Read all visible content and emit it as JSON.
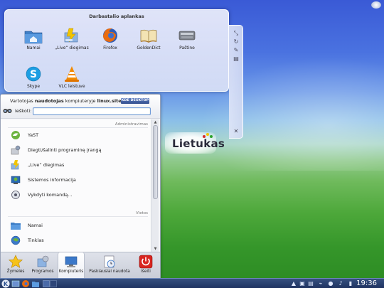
{
  "folderview": {
    "title": "Darbastalio aplankas",
    "icons": [
      {
        "label": "Namai",
        "icon": "home-folder-icon"
      },
      {
        "label": "„Live“ diegimas",
        "icon": "live-install-icon"
      },
      {
        "label": "Firefox",
        "icon": "firefox-icon"
      },
      {
        "label": "GoldenDict",
        "icon": "dictionary-icon"
      },
      {
        "label": "Paštine",
        "icon": "mail-icon"
      },
      {
        "label": "Skype",
        "icon": "skype-icon"
      },
      {
        "label": "VLC leistuve",
        "icon": "vlc-icon"
      }
    ]
  },
  "logo": {
    "text": "Lietukas"
  },
  "kickoff": {
    "user_prefix": "Vartotojas ",
    "user_name": "naudotojas",
    "user_mid": " kompiuteryje ",
    "host_name": "linux.site",
    "kde_badge": "KDE DESKTOP",
    "search_label": "Ieškoti:",
    "search_value": "",
    "section_admin": "Administravimas",
    "section_recent": "Vietos",
    "admin_items": [
      {
        "label": "YaST",
        "icon": "yast-icon"
      },
      {
        "label": "Diegti/šalinti programinę įrangą",
        "icon": "software-install-icon"
      },
      {
        "label": "„Live“ diegimas",
        "icon": "live-install-icon"
      },
      {
        "label": "Sistemos informacija",
        "icon": "system-info-icon"
      },
      {
        "label": "Vykdyti komandą...",
        "icon": "run-command-icon"
      }
    ],
    "places_items": [
      {
        "label": "Namai",
        "icon": "home-folder-icon"
      },
      {
        "label": "Tinklas",
        "icon": "network-icon"
      }
    ],
    "tabs": [
      {
        "label": "Žymelės",
        "icon": "star-icon"
      },
      {
        "label": "Programos",
        "icon": "applications-icon"
      },
      {
        "label": "Kompiuteris",
        "icon": "computer-icon"
      },
      {
        "label": "Paskiausiai naudota",
        "icon": "recent-icon"
      },
      {
        "label": "Išeiti",
        "icon": "power-icon"
      }
    ]
  },
  "taskbar": {
    "clock": "19:36"
  }
}
